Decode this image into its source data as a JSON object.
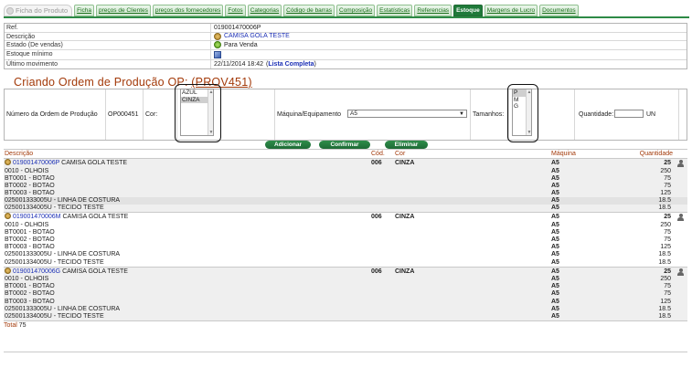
{
  "tabs": [
    {
      "label": "Ficha do Produto",
      "state": "disabled"
    },
    {
      "label": "Ficha",
      "state": "normal"
    },
    {
      "label": "preços de Clientes",
      "state": "normal"
    },
    {
      "label": "preços dos fornecedores",
      "state": "normal"
    },
    {
      "label": "Fotos",
      "state": "normal"
    },
    {
      "label": "Categorias",
      "state": "normal"
    },
    {
      "label": "Código de barras",
      "state": "normal"
    },
    {
      "label": "Composição",
      "state": "normal"
    },
    {
      "label": "Estatísticas",
      "state": "normal"
    },
    {
      "label": "Referencias",
      "state": "normal"
    },
    {
      "label": "Estoque",
      "state": "active"
    },
    {
      "label": "Margens de Lucro",
      "state": "normal"
    },
    {
      "label": "Documentos",
      "state": "normal"
    }
  ],
  "info": {
    "ref_label": "Ref.",
    "ref_value": "019001470006P",
    "desc_label": "Descrição",
    "desc_value": "CAMISA GOLA TESTE",
    "estado_label": "Estado (De vendas)",
    "estado_value": "Para Venda",
    "estoque_min_label": "Estoque mínimo",
    "ultimo_label": "Último movimento",
    "ultimo_date": "22/11/2014 18:42",
    "ultimo_open": "(",
    "ultimo_link": "Lista Completa",
    "ultimo_close": ")"
  },
  "title": {
    "prefix": "Criando Ordem de Produção OP: ",
    "op_link": "(PROV451)"
  },
  "form": {
    "numero_label": "Número da Ordem de Produção",
    "numero_value": "OP000451",
    "cor_label": "Cor:",
    "cor_options": [
      "AZUL",
      "CINZA"
    ],
    "cor_selected": "CINZA",
    "maquina_label": "Máquina/Equipamento",
    "maquina_value": "A5",
    "tamanhos_label": "Tamanhos:",
    "tamanhos_options": [
      "P",
      "M",
      "G"
    ],
    "tamanhos_selected": "P",
    "quantidade_label": "Quantidade:",
    "quantidade_value": "",
    "unit": "UN"
  },
  "buttons": {
    "adicionar": "Adicionar",
    "confirmar": "Confirmar",
    "eliminar": "Eliminar"
  },
  "table": {
    "headers": {
      "descricao": "Descrição",
      "cod": "Cód.",
      "cor": "Cor",
      "maquina": "Máquina",
      "quantidade": "Quantidade"
    },
    "groups": [
      {
        "ref": "019001470006P",
        "name": "CAMISA GOLA TESTE",
        "cod": "006",
        "cor": "CINZA",
        "maquina": "A5",
        "qty": "25",
        "components": [
          {
            "desc": "0010 - OLHOIS",
            "maq": "A5",
            "qty": "250"
          },
          {
            "desc": "BT0001 - BOTAO",
            "maq": "A5",
            "qty": "75"
          },
          {
            "desc": "BT0002 - BOTAO",
            "maq": "A5",
            "qty": "75"
          },
          {
            "desc": "BT0003 - BOTAO",
            "maq": "A5",
            "qty": "125"
          },
          {
            "desc": "025001333005U - LINHA DE COSTURA",
            "maq": "A5",
            "qty": "18.5"
          },
          {
            "desc": "025001334005U - TECIDO TESTE",
            "maq": "A5",
            "qty": "18.5"
          }
        ]
      },
      {
        "ref": "019001470006M",
        "name": "CAMISA GOLA TESTE",
        "cod": "006",
        "cor": "CINZA",
        "maquina": "A5",
        "qty": "25",
        "components": [
          {
            "desc": "0010 - OLHOIS",
            "maq": "A5",
            "qty": "250"
          },
          {
            "desc": "BT0001 - BOTAO",
            "maq": "A5",
            "qty": "75"
          },
          {
            "desc": "BT0002 - BOTAO",
            "maq": "A5",
            "qty": "75"
          },
          {
            "desc": "BT0003 - BOTAO",
            "maq": "A5",
            "qty": "125"
          },
          {
            "desc": "025001333005U - LINHA DE COSTURA",
            "maq": "A5",
            "qty": "18.5"
          },
          {
            "desc": "025001334005U - TECIDO TESTE",
            "maq": "A5",
            "qty": "18.5"
          }
        ]
      },
      {
        "ref": "019001470006G",
        "name": "CAMISA GOLA TESTE",
        "cod": "006",
        "cor": "CINZA",
        "maquina": "A5",
        "qty": "25",
        "components": [
          {
            "desc": "0010 - OLHOIS",
            "maq": "A5",
            "qty": "250"
          },
          {
            "desc": "BT0001 - BOTAO",
            "maq": "A5",
            "qty": "75"
          },
          {
            "desc": "BT0002 - BOTAO",
            "maq": "A5",
            "qty": "75"
          },
          {
            "desc": "BT0003 - BOTAO",
            "maq": "A5",
            "qty": "125"
          },
          {
            "desc": "025001333005U - LINHA DE COSTURA",
            "maq": "A5",
            "qty": "18.5"
          },
          {
            "desc": "025001334005U - TECIDO TESTE",
            "maq": "A5",
            "qty": "18.5"
          }
        ]
      }
    ],
    "total_label": "Total",
    "total_value": "75"
  },
  "colors": {
    "accent_green": "#1f7a3a",
    "title_brown": "#a33a0a",
    "link_blue": "#1b2fb5"
  }
}
